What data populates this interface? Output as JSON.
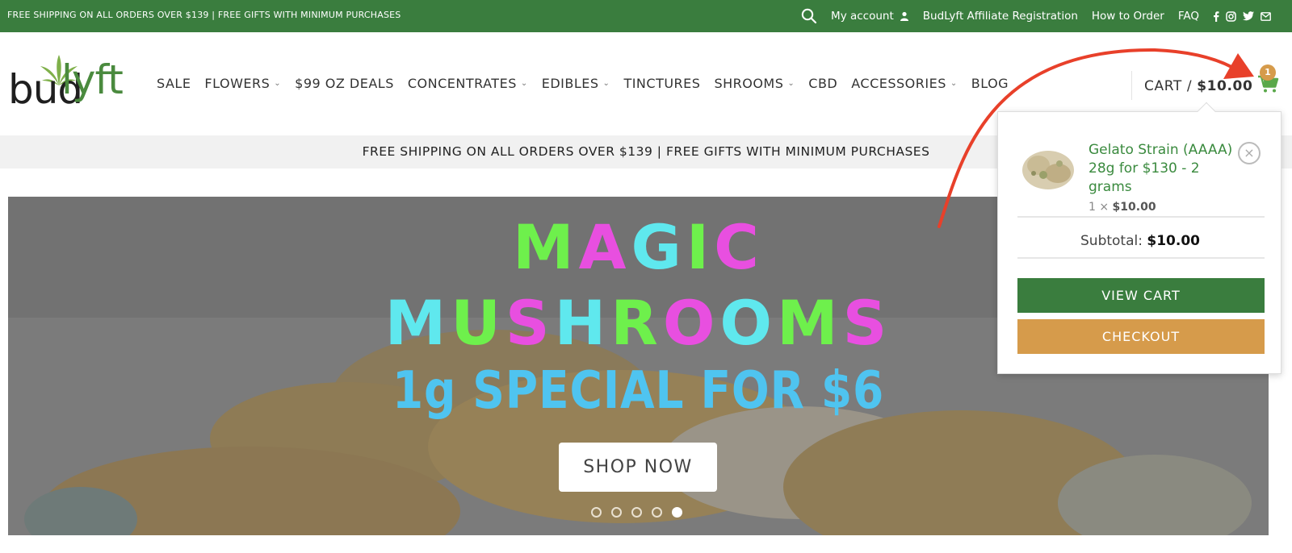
{
  "topbar": {
    "promo": "FREE SHIPPING ON ALL ORDERS OVER $139 | FREE GIFTS WITH MINIMUM PURCHASES",
    "links": {
      "my_account": "My account",
      "affiliate": "BudLyft Affiliate Registration",
      "how_to_order": "How to Order",
      "faq": "FAQ"
    },
    "icons": [
      "search-icon",
      "user-icon",
      "facebook-icon",
      "instagram-icon",
      "twitter-icon",
      "email-icon"
    ]
  },
  "logo": {
    "part1": "bud",
    "part2": "lyft"
  },
  "nav": {
    "items": [
      {
        "label": "SALE"
      },
      {
        "label": "FLOWERS"
      },
      {
        "label": "$99 OZ DEALS"
      },
      {
        "label": "CONCENTRATES"
      },
      {
        "label": "EDIBLES"
      },
      {
        "label": "TINCTURES"
      },
      {
        "label": "SHROOMS"
      },
      {
        "label": "CBD"
      },
      {
        "label": "ACCESSORIES"
      },
      {
        "label": "BLOG"
      }
    ]
  },
  "cart": {
    "label": "CART /",
    "total": "$10.00",
    "count": "1"
  },
  "shipbar": {
    "text": "FREE SHIPPING ON ALL ORDERS OVER $139 | FREE GIFTS WITH MINIMUM PURCHASES"
  },
  "hero": {
    "line1": [
      "M",
      "A",
      "G",
      "I",
      "C"
    ],
    "line2": [
      "M",
      "U",
      "S",
      "H",
      "R",
      "O",
      "O",
      "M",
      "S"
    ],
    "line3": "1g SPECIAL FOR $6",
    "cta": "SHOP NOW",
    "slides": 5,
    "active_slide": 5,
    "colors": {
      "green": "#6ef04c",
      "magenta": "#e84fe0",
      "cyan": "#5fe8ee",
      "blue": "#4fc4f0"
    }
  },
  "minicart": {
    "product_name": "Gelato Strain (AAAA) 28g for $130 - 2 grams",
    "qty": "1 ×",
    "price": "$10.00",
    "subtotal_label": "Subtotal:",
    "subtotal_value": "$10.00",
    "view_cart": "VIEW CART",
    "checkout": "CHECKOUT",
    "remove": "×"
  },
  "colors": {
    "brand_green": "#3a7d3e",
    "accent_gold": "#d69b4b",
    "annotation_red": "#e8402a"
  }
}
